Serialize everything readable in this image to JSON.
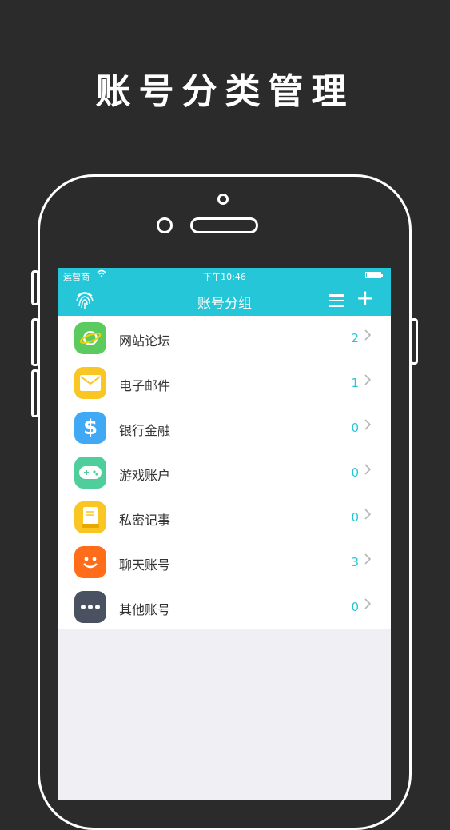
{
  "headline": "账号分类管理",
  "status_bar": {
    "carrier": "运营商",
    "wifi": "wifi",
    "time": "下午10:46",
    "battery": "battery"
  },
  "navbar": {
    "title": "账号分组",
    "left_icon": "fingerprint-icon",
    "menu_icon": "menu-icon",
    "add_icon": "+"
  },
  "colors": {
    "accent": "#25c6d8",
    "background": "#2b2b2b",
    "list_bg": "#ffffff",
    "screen_bg": "#efeff4"
  },
  "groups": [
    {
      "label": "网站论坛",
      "count": "2",
      "icon": "planet-icon",
      "color": "#5ccb5f"
    },
    {
      "label": "电子邮件",
      "count": "1",
      "icon": "envelope-icon",
      "color": "#f9c623"
    },
    {
      "label": "银行金融",
      "count": "0",
      "icon": "dollar-icon",
      "color": "#3fa9f5"
    },
    {
      "label": "游戏账户",
      "count": "0",
      "icon": "gamepad-icon",
      "color": "#4fce9b"
    },
    {
      "label": "私密记事",
      "count": "0",
      "icon": "notebook-icon",
      "color": "#f9c623"
    },
    {
      "label": "聊天账号",
      "count": "3",
      "icon": "smiley-icon",
      "color": "#ff6d1a"
    },
    {
      "label": "其他账号",
      "count": "0",
      "icon": "more-icon",
      "color": "#4a5160"
    }
  ]
}
